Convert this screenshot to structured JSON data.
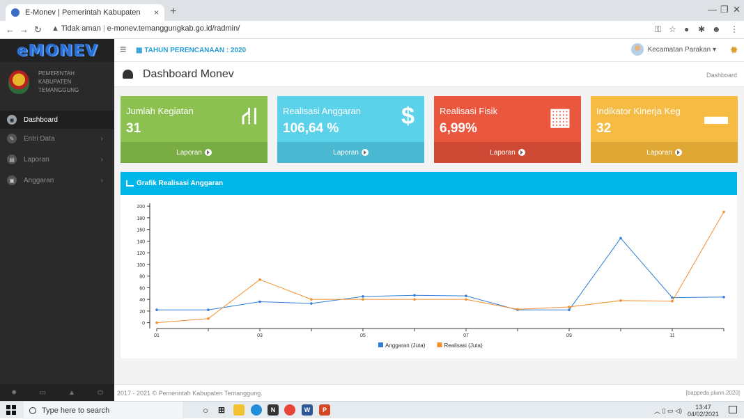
{
  "browser": {
    "tab_title": "E-Monev | Pemerintah Kabupaten",
    "tab_close": "×",
    "new_tab": "+",
    "security_label": "Tidak aman",
    "url": "e-monev.temanggungkab.go.id/radmin/"
  },
  "header": {
    "logo": "eMONEV",
    "plan_label": "TAHUN PERENCANAAN : 2020",
    "user": "Kecamatan Parakan"
  },
  "sidebar": {
    "brand_lines": [
      "PEMERINTAH",
      "KABUPATEN",
      "TEMANGGUNG"
    ],
    "items": [
      {
        "label": "Dashboard",
        "active": true,
        "icon": "dashboard-icon"
      },
      {
        "label": "Entri Data",
        "active": false,
        "icon": "entry-icon"
      },
      {
        "label": "Laporan",
        "active": false,
        "icon": "report-icon"
      },
      {
        "label": "Anggaran",
        "active": false,
        "icon": "budget-icon"
      }
    ]
  },
  "page": {
    "title": "Dashboard Monev",
    "breadcrumb": "Dashboard"
  },
  "cards": [
    {
      "label": "Jumlah Kegiatan",
      "value": "31",
      "footer": "Laporan",
      "color": "#8cc152",
      "footer_color": "#7aac44",
      "icon": "road-icon"
    },
    {
      "label": "Realisasi Anggaran",
      "value": "106,64 %",
      "footer": "Laporan",
      "color": "#5bd1ea",
      "footer_color": "#4ab8d0",
      "icon": "dollar-icon"
    },
    {
      "label": "Realisasi Fisik",
      "value": "6,99%",
      "footer": "Laporan",
      "color": "#e9573f",
      "footer_color": "#cf4a34",
      "icon": "building-icon"
    },
    {
      "label": "Indikator Kinerja Keg",
      "value": "32",
      "footer": "Laporan",
      "color": "#f6bb42",
      "footer_color": "#dfa733",
      "icon": "briefcase-icon"
    }
  ],
  "chart_panel": {
    "title": "Grafik Realisasi Anggaran"
  },
  "chart_data": {
    "type": "line",
    "x": [
      "01",
      "02",
      "03",
      "04",
      "05",
      "06",
      "07",
      "08",
      "09",
      "10",
      "11",
      "12"
    ],
    "tick_labels_shown": [
      "01",
      "",
      "03",
      "",
      "05",
      "",
      "07",
      "",
      "09",
      "",
      "11",
      ""
    ],
    "ylim": [
      -10,
      205
    ],
    "yticks": [
      0,
      20,
      40,
      60,
      80,
      100,
      120,
      140,
      160,
      180,
      200
    ],
    "grid": false,
    "legend": "bottom",
    "series": [
      {
        "name": "Anggaran (Juta)",
        "color": "#2f7ed8",
        "values": [
          22,
          22,
          36,
          33,
          45,
          47,
          46,
          22,
          22,
          145,
          43,
          44
        ]
      },
      {
        "name": "Realisasi (Juta)",
        "color": "#f28f2c",
        "values": [
          0,
          7,
          74,
          40,
          40,
          40,
          40,
          23,
          27,
          38,
          37,
          190
        ]
      }
    ]
  },
  "footer": {
    "copyright": "2017 - 2021 © Pemerintah Kabupaten Temanggung.",
    "version": "[bappeda plann 2020]"
  },
  "taskbar": {
    "search_placeholder": "Type here to search",
    "time": "13:47",
    "date": "04/02/2021"
  }
}
